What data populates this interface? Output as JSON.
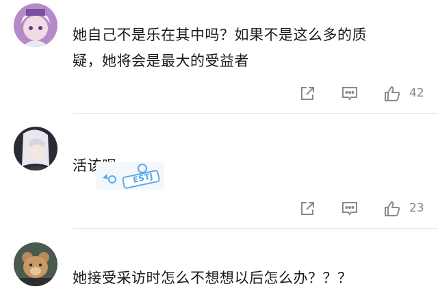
{
  "comments": [
    {
      "avatar": "anime-girl-avatar",
      "text_line1": "她自己不是乐在其中吗？如果不是这么多的质",
      "text_line2": "疑，她将会是最大的受益者",
      "likes": "42"
    },
    {
      "avatar": "dark-hair-girl-avatar",
      "text_line1": "活该呗",
      "sticker_text": "ESTJ",
      "likes": "23"
    },
    {
      "avatar": "bear-avatar",
      "text_line1": "她接受采访时怎么不想想以后怎么办？？？"
    }
  ],
  "icons": {
    "share": "share-icon",
    "comment": "comment-icon",
    "like": "thumbs-up-icon"
  },
  "colors": {
    "icon": "#8a8a8a",
    "text": "#1a1a1a",
    "count": "#888888",
    "divider": "#e6e6e6",
    "sticker": "#5aa9e6"
  }
}
